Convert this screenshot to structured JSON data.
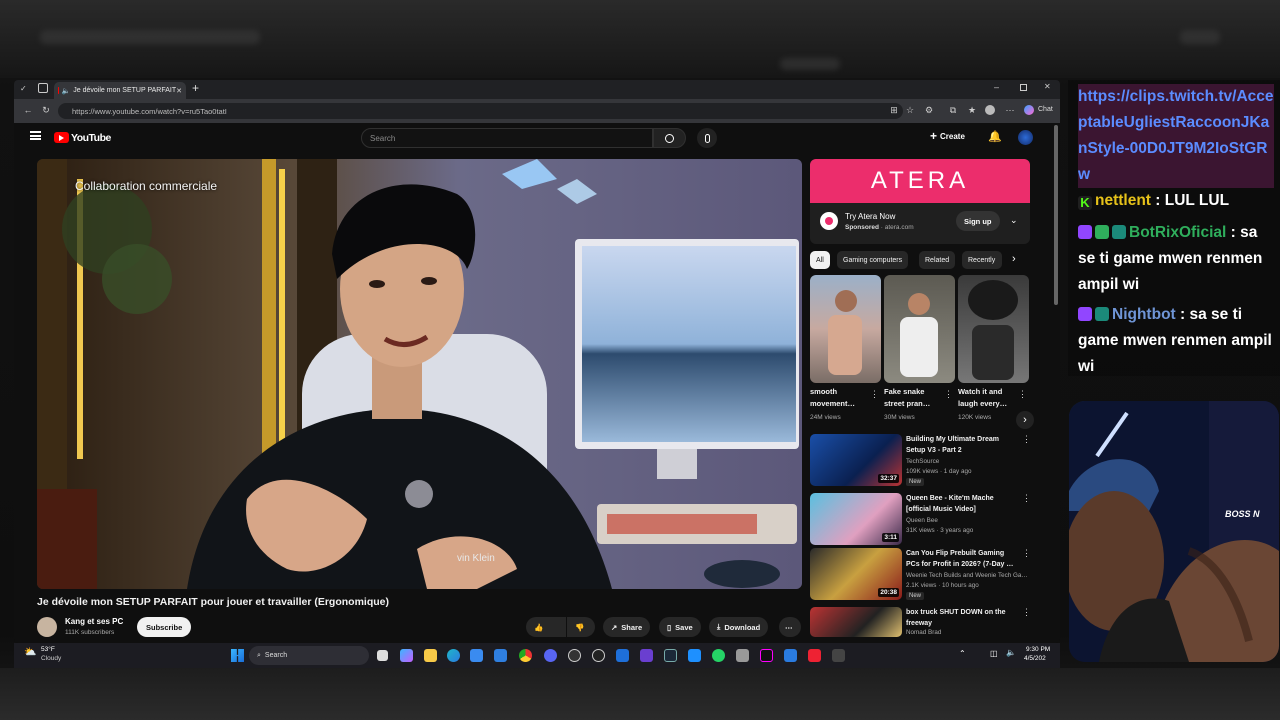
{
  "browser": {
    "tab_title": "Je dévoile mon SETUP PARFAIT",
    "url": "https://www.youtube.com/watch?v=ru5Tao0tatI",
    "chat_label": "Chat"
  },
  "youtube": {
    "logo": "YouTube",
    "search_placeholder": "Search",
    "create_label": "Create",
    "video": {
      "overlay_text": "Collaboration commerciale",
      "title": "Je dévoile mon SETUP PARFAIT pour jouer et travailler (Ergonomique)",
      "brand_text": "vin Klein"
    },
    "channel": {
      "name": "Kang et ses PC",
      "subscribers": "111K subscribers",
      "subscribe_label": "Subscribe"
    },
    "actions": {
      "share": "Share",
      "save": "Save",
      "download": "Download"
    },
    "ad": {
      "brand": "ATERA",
      "headline": "Try Atera Now",
      "sponsored": "Sponsored",
      "domain": "atera.com",
      "cta": "Sign up"
    },
    "chips": [
      "All",
      "Gaming computers",
      "Related",
      "Recently"
    ],
    "shorts": [
      {
        "title": "smooth movement…",
        "views": "24M views"
      },
      {
        "title": "Fake snake street pran…",
        "views": "30M views"
      },
      {
        "title": "Watch it and laugh every…",
        "views": "120K views"
      }
    ],
    "related": [
      {
        "title": "Building My Ultimate Dream Setup V3 - Part 2",
        "channel": "TechSource",
        "meta": "109K views · 1 day ago",
        "badge": "New",
        "duration": "32:37"
      },
      {
        "title": "Queen Bee - Kite'm Mache [official Music Video]",
        "channel": "Queen Bee",
        "meta": "31K views · 3 years ago",
        "badge": "",
        "duration": "3:11"
      },
      {
        "title": "Can You Flip Prebuilt Gaming PCs for Profit in 2026? (7-Day …",
        "channel": "Weenie Tech Builds and Weenie Tech Ga…",
        "meta": "2.1K views · 10 hours ago",
        "badge": "New",
        "duration": "20:38"
      },
      {
        "title": "box truck SHUT DOWN on the freeway",
        "channel": "Nomad Brad",
        "meta": "",
        "badge": "",
        "duration": ""
      }
    ]
  },
  "taskbar": {
    "weather_temp": "53°F",
    "weather_desc": "Cloudy",
    "search": "Search",
    "time": "9:30 PM",
    "date": "4/5/202"
  },
  "chat": {
    "link": "https://clips.twitch.tv/AcceptableUgliestRaccoonJKanStyle-00D0JT9M2IoStGRw",
    "messages": [
      {
        "user": "nettlent",
        "text": "LUL LUL",
        "color": "#e6c21a"
      },
      {
        "user": "BotRixOficial",
        "text": "sa se ti game mwen renmen ampil wi",
        "color": "#2fae5c"
      },
      {
        "user": "Nightbot",
        "text": "sa se ti game mwen renmen ampil wi",
        "color": "#6f95d6"
      }
    ]
  },
  "webcam": {
    "shirt_text": "BOSS N"
  }
}
